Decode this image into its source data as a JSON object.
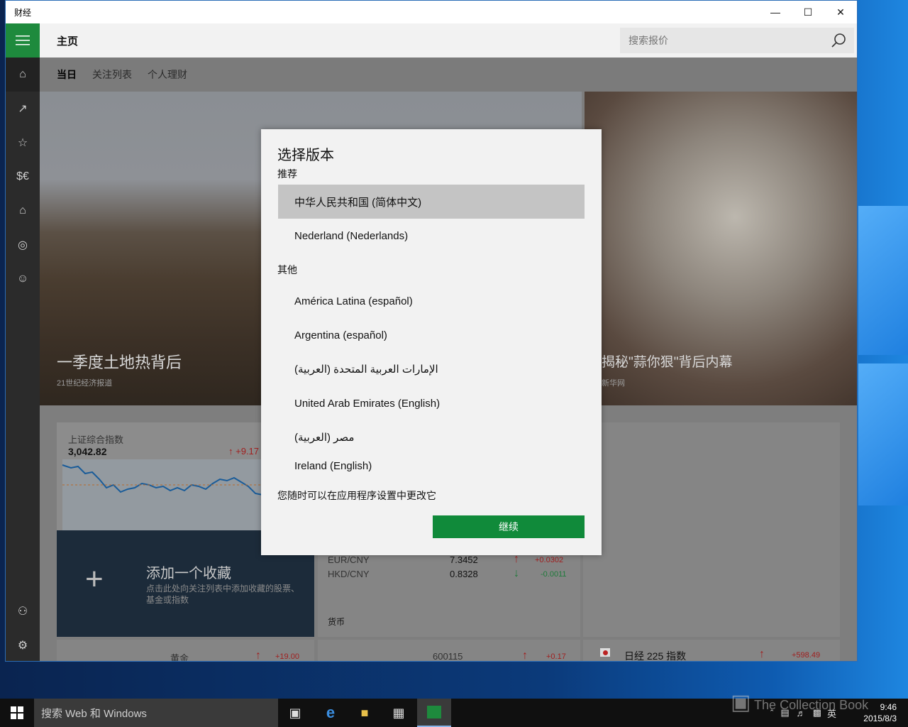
{
  "window": {
    "title": "财经"
  },
  "header": {
    "page_title": "主页",
    "search_placeholder": "搜索报价"
  },
  "subtabs": [
    "当日",
    "关注列表",
    "个人理财"
  ],
  "heroes": [
    {
      "title": "一季度土地热背后",
      "source": "21世纪经济报道"
    },
    {
      "title": "揭秘\"蒜你狠\"背后内幕",
      "source": "新华网"
    }
  ],
  "index_tile": {
    "name": "上证综合指数",
    "value": "3,042.82",
    "change": "+9.17"
  },
  "add_tile": {
    "title": "添加一个收藏",
    "desc": "点击此处向关注列表中添加收藏的股票、基金或指数"
  },
  "currency": {
    "rows": [
      {
        "pair": "EUR/CNY",
        "value": "7.3452",
        "change": "+0.0302"
      },
      {
        "pair": "HKD/CNY",
        "value": "0.8328",
        "change": "-0.0011"
      }
    ],
    "label": "货币"
  },
  "bottom_row": [
    {
      "name": "黄金",
      "change": "+19.00"
    },
    {
      "name": "600115",
      "change": "+0.17"
    },
    {
      "name": "日经 225 指数",
      "change": "+598.49"
    }
  ],
  "dialog": {
    "title": "选择版本",
    "recommended_label": "推荐",
    "recommended": [
      "中华人民共和国 (简体中文)",
      "Nederland (Nederlands)"
    ],
    "other_label": "其他",
    "other": [
      "América Latina (español)",
      "Argentina (español)",
      "الإمارات العربية المتحدة (العربية)",
      "United Arab Emirates (English)",
      "مصر (العربية)",
      "Ireland (English)"
    ],
    "hint": "您随时可以在应用程序设置中更改它",
    "continue": "继续"
  },
  "taskbar": {
    "search_text": "搜索 Web 和 Windows",
    "lang": "英",
    "time": "9:46",
    "date": "2015/8/3"
  },
  "watermark": "The Collection Book",
  "colors": {
    "accent": "#1e8a3d",
    "button": "#108a3a",
    "sidebar": "#2b2b2b"
  }
}
